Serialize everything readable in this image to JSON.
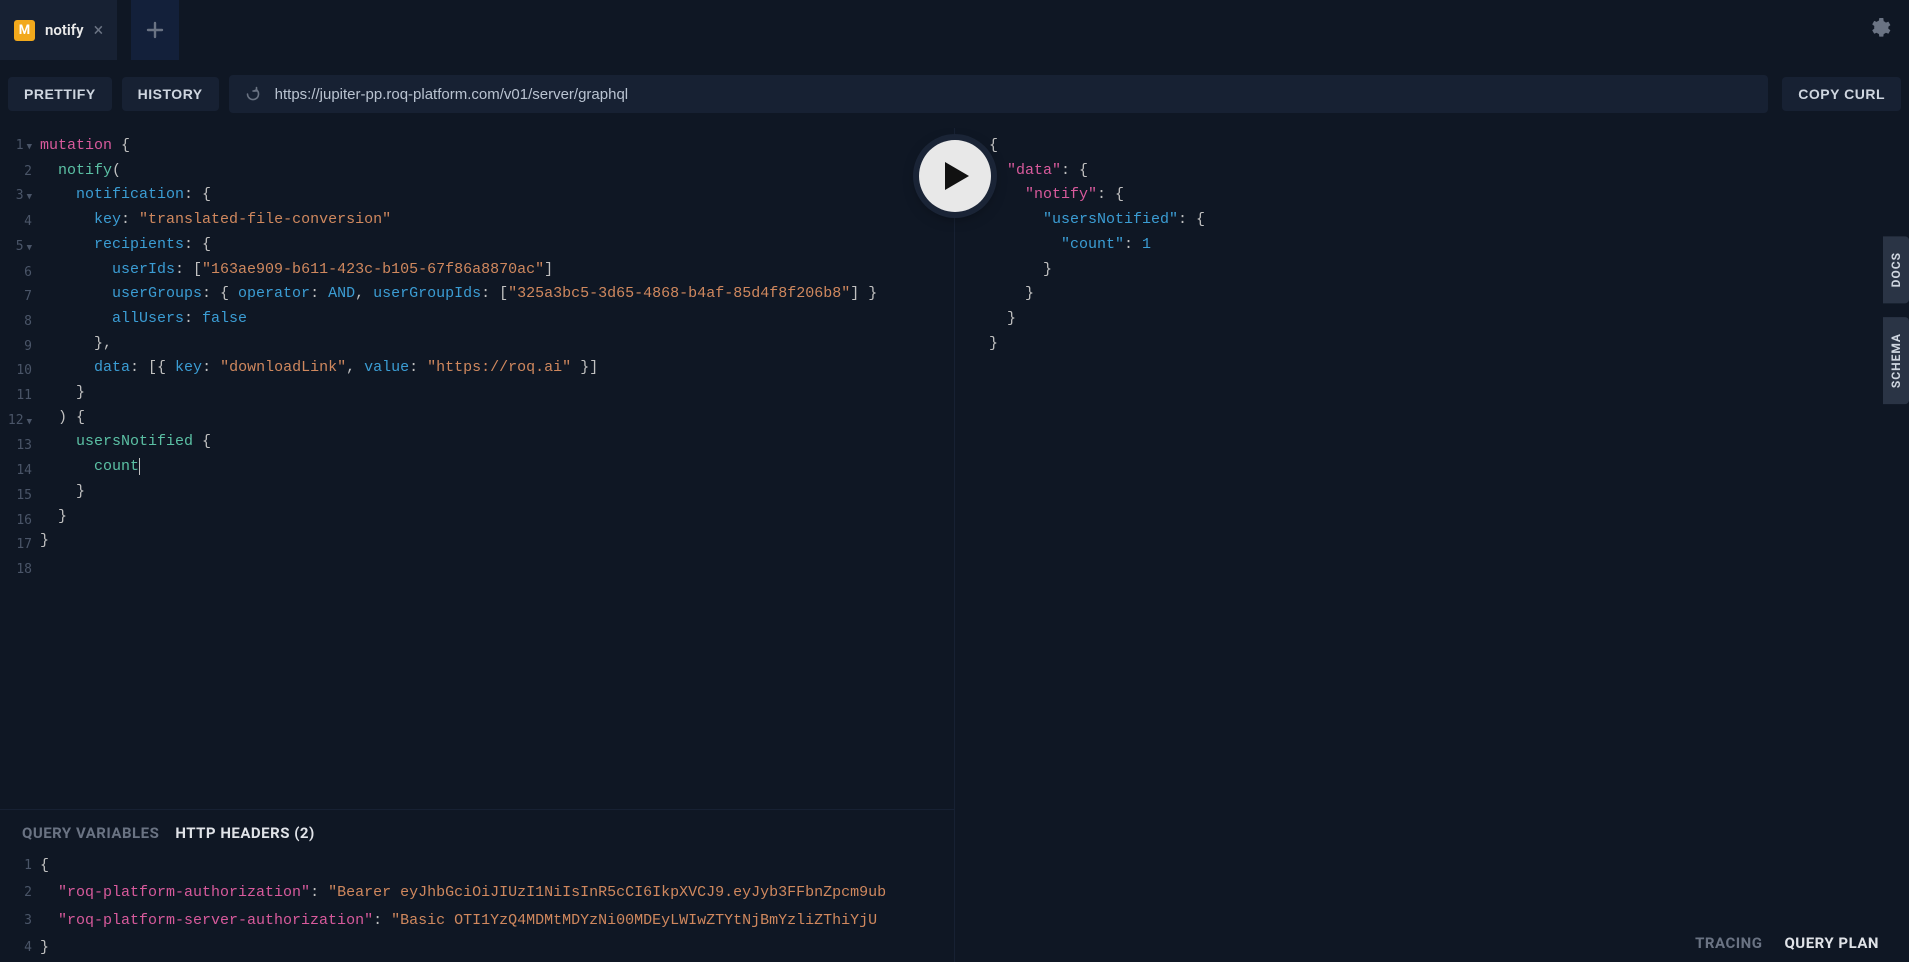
{
  "tab": {
    "badge": "M",
    "label": "notify"
  },
  "toolbar": {
    "prettify": "PRETTIFY",
    "history": "HISTORY",
    "url": "https://jupiter-pp.roq-platform.com/v01/server/graphql",
    "copy_curl": "COPY CURL"
  },
  "side": {
    "docs": "DOCS",
    "schema": "SCHEMA"
  },
  "query": {
    "line_count": 18,
    "fold_lines": [
      1,
      3,
      5,
      12
    ],
    "kw_mutation": "mutation",
    "fn_notify": "notify",
    "attr_notification": "notification",
    "attr_key": "key",
    "str_key": "\"translated-file-conversion\"",
    "attr_recipients": "recipients",
    "attr_userIds": "userIds",
    "str_userId": "\"163ae909-b611-423c-b105-67f86a8870ac\"",
    "attr_userGroups": "userGroups",
    "attr_operator": "operator",
    "const_and": "AND",
    "attr_userGroupIds": "userGroupIds",
    "str_groupId": "\"325a3bc5-3d65-4868-b4af-85d4f8f206b8\"",
    "attr_allUsers": "allUsers",
    "const_false": "false",
    "attr_data": "data",
    "str_dlkey": "\"downloadLink\"",
    "attr_value": "value",
    "str_dlval": "\"https://roq.ai\"",
    "fn_usersNotified": "usersNotified",
    "fn_count": "count"
  },
  "drawer": {
    "tab_vars": "QUERY VARIABLES",
    "tab_headers": "HTTP HEADERS (2)",
    "h1_key": "\"roq-platform-authorization\"",
    "h1_val": "\"Bearer eyJhbGciOiJIUzI1NiIsInR5cCI6IkpXVCJ9.eyJyb3FFbnZpcm9ub",
    "h2_key": "\"roq-platform-server-authorization\"",
    "h2_val": "\"Basic OTI1YzQ4MDMtMDYzNi00MDEyLWIwZTYtNjBmYzliZThiYjU"
  },
  "result": {
    "data_key": "\"data\"",
    "notify_key": "\"notify\"",
    "users_key": "\"usersNotified\"",
    "count_key": "\"count\"",
    "count_val": "1"
  },
  "footer": {
    "tracing": "TRACING",
    "queryplan": "QUERY PLAN"
  }
}
